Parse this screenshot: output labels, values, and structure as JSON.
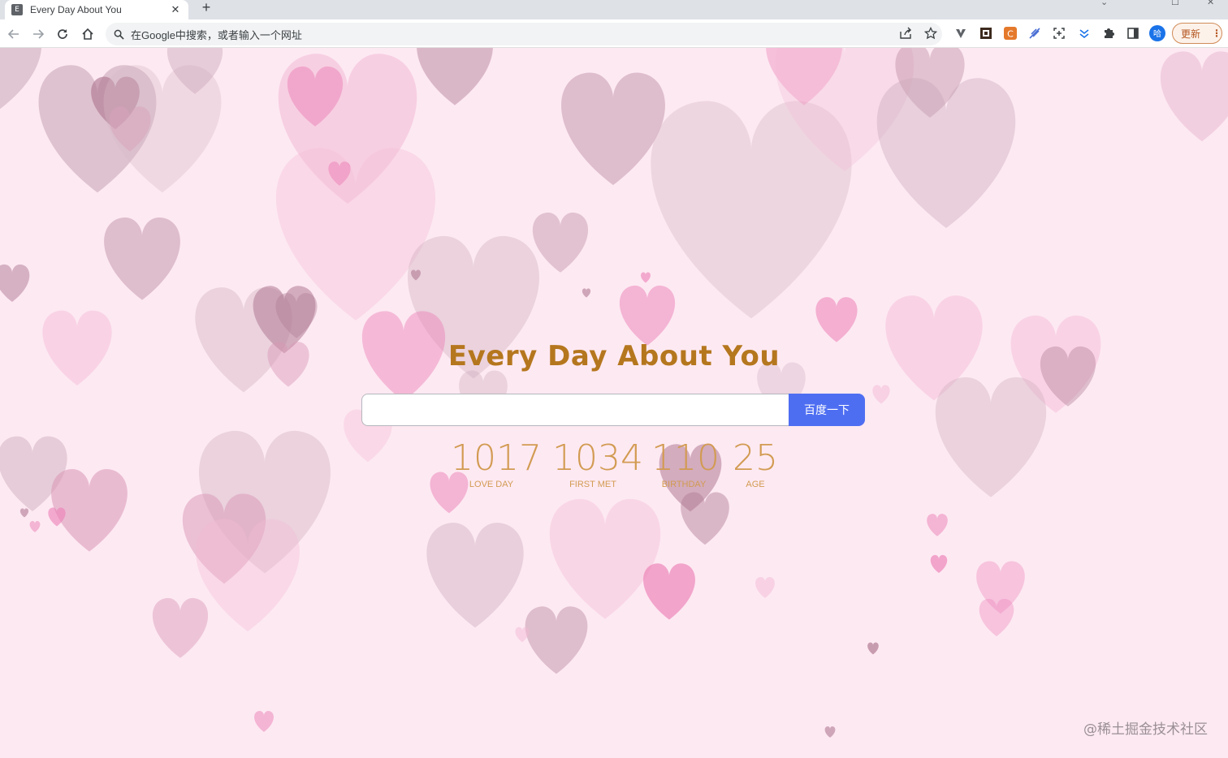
{
  "browser": {
    "tab_title": "Every Day About You",
    "tab_favicon_letter": "E",
    "new_tab_symbol": "+",
    "tab_close_symbol": "✕",
    "address_text": "在Google中搜索，或者输入一个网址",
    "update_label": "更新",
    "avatar_letter": "哈"
  },
  "page": {
    "title": "Every Day About You",
    "search_placeholder": "",
    "search_button": "百度一下",
    "counters": [
      {
        "value": "1017",
        "label": "LOVE DAY"
      },
      {
        "value": "1034",
        "label": "FIRST MET"
      },
      {
        "value": "110",
        "label": "BIRTHDAY"
      },
      {
        "value": "25",
        "label": "AGE"
      }
    ],
    "watermark": "@稀土掘金技术社区"
  },
  "colors": {
    "background": "#fde9f2",
    "title": "#b5771e",
    "counter": "#d29b52",
    "button": "#4e6ef2",
    "heart_palette": [
      "#b07a93",
      "#d996b6",
      "#ec7fb6",
      "#c9a8b8",
      "#f3b9d5",
      "#d6b9c6"
    ]
  },
  "icons": {
    "back": "arrow-left-icon",
    "forward": "arrow-right-icon",
    "reload": "reload-icon",
    "home": "home-icon",
    "search": "search-icon",
    "share": "share-icon",
    "bookmark": "star-icon",
    "extensions": "puzzle-icon",
    "side_panel": "side-panel-icon",
    "menu": "kebab-menu-icon"
  }
}
